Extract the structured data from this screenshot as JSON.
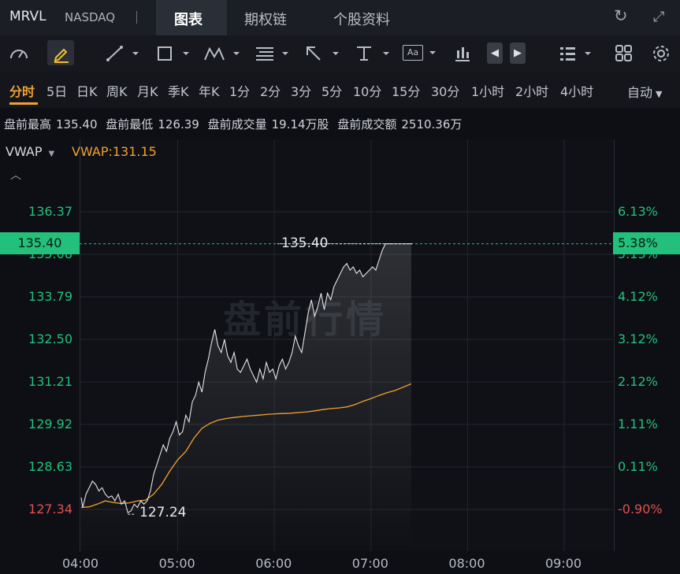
{
  "header": {
    "symbol": "MRVL",
    "exchange": "NASDAQ",
    "tabs": [
      "图表",
      "期权链",
      "个股资料"
    ],
    "refresh_icon": "refresh-icon",
    "fullscreen_icon": "expand-icon"
  },
  "toolbar": {
    "tools": [
      "indicator-gauge-icon",
      "pencil-icon",
      "line-tool-icon",
      "rectangle-tool-icon",
      "pattern-tool-icon",
      "fib-tool-icon",
      "arrow-tool-icon",
      "text-tool-icon",
      "annotation-tool-icon",
      "candle-tool-icon",
      "prev-arrow-icon",
      "next-arrow-icon",
      "list-icon",
      "grid-icon",
      "settings-icon"
    ],
    "annotation_text": "Aa"
  },
  "periods": {
    "items": [
      "分时",
      "5日",
      "日K",
      "周K",
      "月K",
      "季K",
      "年K",
      "1分",
      "2分",
      "3分",
      "5分",
      "10分",
      "15分",
      "30分",
      "1小时",
      "2小时",
      "4小时"
    ],
    "active": "分时",
    "mode": "自动"
  },
  "info": {
    "pre_high_label": "盘前最高",
    "pre_high": "135.40",
    "pre_low_label": "盘前最低",
    "pre_low": "126.39",
    "pre_vol_label": "盘前成交量",
    "pre_vol": "19.14万股",
    "pre_amt_label": "盘前成交额",
    "pre_amt": "2510.36万"
  },
  "indicator": {
    "name": "VWAP",
    "value_text": "VWAP:131.15"
  },
  "watermark": "盘前行情",
  "current": {
    "price": "135.40",
    "pct": "5.38%"
  },
  "markers": {
    "high": "135.40",
    "low": "127.24"
  },
  "colors": {
    "up": "#23c07b",
    "down": "#e0524f",
    "vwap": "#f0a230",
    "price_line": "#e2e4e8",
    "active": "#f0a230"
  },
  "chart_data": {
    "type": "line",
    "x_ticks": [
      "04:00",
      "05:00",
      "06:00",
      "07:00",
      "08:00",
      "09:00"
    ],
    "y_ticks": [
      "136.37",
      "135.08",
      "133.79",
      "132.50",
      "131.21",
      "129.92",
      "128.63",
      "127.34"
    ],
    "pct_ticks": [
      "6.13%",
      "5.13%",
      "4.12%",
      "3.12%",
      "2.12%",
      "1.11%",
      "0.11%",
      "-0.90%"
    ],
    "ylim": [
      126.4,
      137.2
    ],
    "xlim_minutes": [
      0,
      330
    ],
    "series": [
      {
        "x": [
          0,
          1,
          3,
          5,
          7,
          9,
          11,
          13,
          15,
          17,
          19,
          21,
          23,
          25,
          27,
          29,
          31,
          33,
          35,
          37,
          39,
          41,
          43,
          45,
          47,
          49,
          51,
          53,
          55,
          57,
          59,
          61,
          63,
          65,
          67,
          69,
          71,
          73,
          75,
          77,
          79,
          81,
          83,
          85,
          87,
          89,
          91,
          93,
          95,
          97,
          99,
          101,
          103,
          105,
          107,
          109,
          111,
          113,
          115,
          117,
          119,
          121,
          123,
          125,
          127,
          129,
          131,
          133,
          135,
          137,
          139,
          141,
          143,
          145,
          147,
          149,
          151,
          153,
          155,
          157,
          159,
          161,
          163,
          165,
          167,
          169,
          171,
          173,
          175,
          177,
          179,
          181,
          183,
          185,
          187,
          189,
          191,
          193,
          195,
          197,
          199,
          201,
          203,
          205
        ],
        "y": [
          127.7,
          127.4,
          127.8,
          128.0,
          128.2,
          128.1,
          127.9,
          128.0,
          127.8,
          127.7,
          127.75,
          127.6,
          127.8,
          127.5,
          127.6,
          127.24,
          127.3,
          127.5,
          127.4,
          127.6,
          127.5,
          127.6,
          127.9,
          128.4,
          128.7,
          129.0,
          129.3,
          129.1,
          129.5,
          129.7,
          130.0,
          129.6,
          129.7,
          130.2,
          130.0,
          130.6,
          130.8,
          131.2,
          130.9,
          131.5,
          131.9,
          132.4,
          132.8,
          132.3,
          132.1,
          132.5,
          132.0,
          131.8,
          132.1,
          131.6,
          131.5,
          131.7,
          131.9,
          131.6,
          131.4,
          131.2,
          131.6,
          131.3,
          131.8,
          131.5,
          131.6,
          131.3,
          131.7,
          131.9,
          131.6,
          131.8,
          132.1,
          132.6,
          132.3,
          132.1,
          132.7,
          133.3,
          133.7,
          133.2,
          133.5,
          133.9,
          133.4,
          133.9,
          133.7,
          134.1,
          134.3,
          134.5,
          134.7,
          134.8,
          134.6,
          134.7,
          134.5,
          134.6,
          134.4,
          134.5,
          134.6,
          134.7,
          134.6,
          134.9,
          135.2,
          135.4,
          135.4,
          135.4,
          135.4,
          135.4,
          135.4,
          135.4,
          135.4,
          135.4
        ],
        "color": "#e2e4e8"
      },
      {
        "x": [
          0,
          5,
          10,
          15,
          20,
          25,
          30,
          35,
          40,
          45,
          50,
          55,
          60,
          65,
          70,
          75,
          80,
          85,
          90,
          95,
          100,
          105,
          110,
          115,
          120,
          125,
          130,
          135,
          140,
          145,
          150,
          155,
          160,
          165,
          170,
          175,
          180,
          185,
          190,
          195,
          200,
          205
        ],
        "y": [
          127.4,
          127.42,
          127.5,
          127.6,
          127.55,
          127.52,
          127.54,
          127.6,
          127.62,
          127.8,
          128.1,
          128.5,
          128.85,
          129.1,
          129.5,
          129.8,
          129.95,
          130.05,
          130.1,
          130.13,
          130.16,
          130.18,
          130.2,
          130.22,
          130.24,
          130.25,
          130.26,
          130.28,
          130.3,
          130.33,
          130.37,
          130.4,
          130.42,
          130.45,
          130.52,
          130.62,
          130.7,
          130.8,
          130.88,
          130.95,
          131.05,
          131.15
        ],
        "color": "#f0a230"
      }
    ],
    "grid": true,
    "legend": "top-left"
  }
}
